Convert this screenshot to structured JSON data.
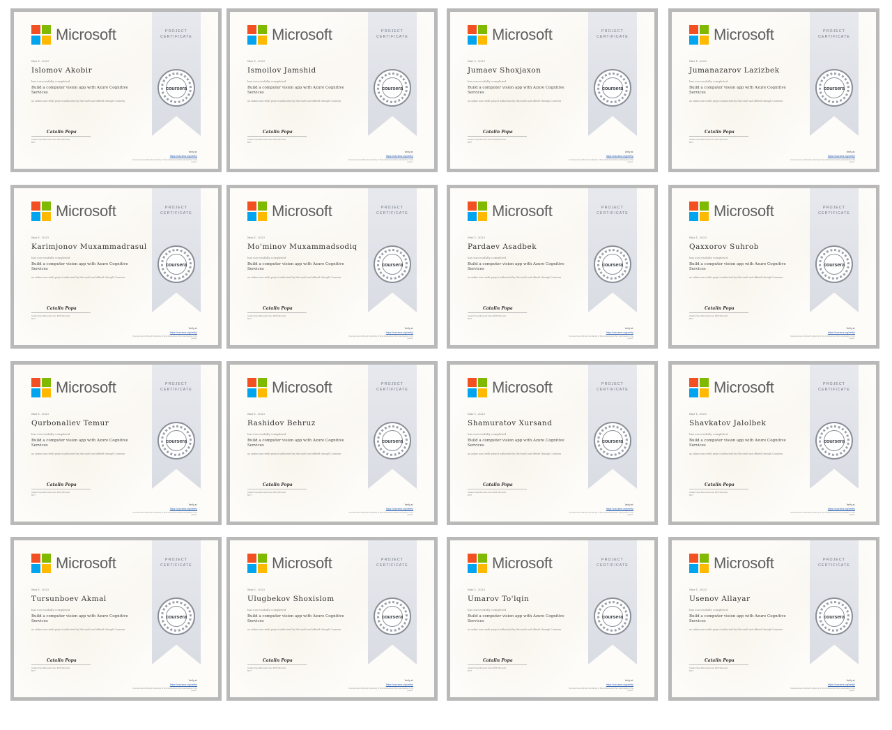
{
  "certificate_common": {
    "brand": "Microsoft",
    "ribbon_line1": "PROJECT",
    "ribbon_line2": "CERTIFICATE",
    "seal_brand": "coursera",
    "date": "Mar 1, 2023",
    "completed_text": "has successfully completed",
    "course_title": "Build a computer vision app with Azure Cognitive Services",
    "description": "an online non-credit project authorized by Microsoft and offered through Coursera",
    "signature": "Catalin Popa",
    "signer_details": "Catalin Popa Microsoft Azure MVP Microsoft MCT",
    "verify_label": "Verify at:",
    "verify_link": "https://coursera.org/verify/",
    "footnote": "Coursera has confirmed the identity of this individual and their participation in the project."
  },
  "certificates": [
    {
      "name": "Islomov Akobir"
    },
    {
      "name": "Ismoilov Jamshid"
    },
    {
      "name": "Jumaev Shoxjaxon"
    },
    {
      "name": "Jumanazarov Lazizbek"
    },
    {
      "name": "Karimjonov Muxammadrasul"
    },
    {
      "name": "Mo'minov Muxammadsodiq"
    },
    {
      "name": "Pardaev Asadbek"
    },
    {
      "name": "Qaxxorov Suhrob"
    },
    {
      "name": "Qurbonaliev Temur"
    },
    {
      "name": "Rashidov Behruz"
    },
    {
      "name": "Shamuratov Xursand"
    },
    {
      "name": "Shavkatov Jalolbek"
    },
    {
      "name": "Tursunboev Akmal"
    },
    {
      "name": "Ulugbekov Shoxislom"
    },
    {
      "name": "Umarov To'lqin"
    },
    {
      "name": "Usenov Allayar"
    }
  ],
  "colors": {
    "ms_red": "#f25022",
    "ms_green": "#7fba00",
    "ms_blue": "#00a4ef",
    "ms_yellow": "#ffb900",
    "frame": "#b9b9b9",
    "ribbon": "#dfe2e8"
  }
}
